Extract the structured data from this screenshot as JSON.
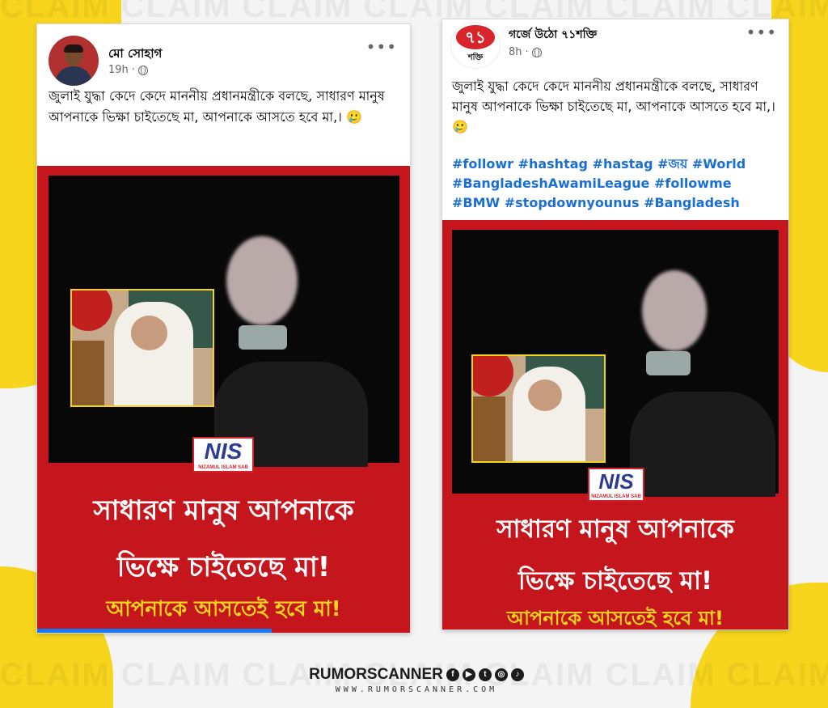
{
  "background": {
    "watermark": "CLAIM CLAIM CLAIM CLAIM CLAIM CLAIM CLAIM CLAIM"
  },
  "post1": {
    "author": "মো সোহাগ",
    "time": "19h",
    "text": "জুলাই যুদ্ধা কেদে কেদে মাননীয় প্রধানমন্ত্রীকে বলছে, সাধারণ মানুষ আপনাকে ভিক্ষা   চাইতেছে মা, আপনাকে আসতে হবে মা,। 🥲",
    "video": {
      "logo": "NIS",
      "logo_sub": "NIZAMUL ISLAM SAB",
      "caption_line1": "সাধারণ মানুষ আপনাকে",
      "caption_line2": "ভিক্ষে চাইতেছে মা!",
      "caption_line3": "আপনাকে আসতেই হবে মা!",
      "progress_percent": 63
    }
  },
  "post2": {
    "author": "গর্জে উঠো ৭১শক্তি",
    "time": "8h",
    "avatar_text": "৭১",
    "avatar_sub": "শক্তি",
    "text": "জুলাই যুদ্ধা কেদে কেদে মাননীয় প্রধানমন্ত্রীকে বলছে, সাধারণ মানুষ আপনাকে ভিক্ষা   চাইতেছে মা, আপনাকে আসতে হবে মা,। 🥲",
    "hashtags": "#followr #hashtag #hastag #জয় #World #BangladeshAwamiLeague #followme #BMW #stopdownyounus #Bangladesh",
    "video": {
      "logo": "NIS",
      "logo_sub": "NIZAMUL ISLAM SAB",
      "caption_line1": "সাধারণ মানুষ আপনাকে",
      "caption_line2": "ভিক্ষে চাইতেছে মা!",
      "caption_line3": "আপনাকে আসতেই হবে মা!"
    }
  },
  "brand": {
    "name": "RUMORSCANNER",
    "url": "WWW.RUMORSCANNER.COM",
    "social_icons": [
      "facebook-icon",
      "youtube-icon",
      "twitter-icon",
      "instagram-icon",
      "tiktok-icon"
    ]
  },
  "colors": {
    "accent_yellow": "#f7d51d",
    "video_red": "#c4161c",
    "link_blue": "#1a6fd6"
  }
}
